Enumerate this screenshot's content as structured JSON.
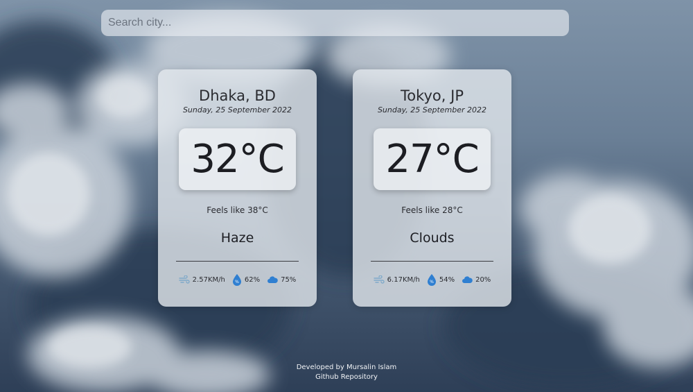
{
  "search": {
    "placeholder": "Search city..."
  },
  "cards": [
    {
      "city": "Dhaka, BD",
      "date": "Sunday, 25 September 2022",
      "temperature": "32°C",
      "feels_like": "Feels like 38°C",
      "condition": "Haze",
      "wind": "2.57KM/h",
      "humidity": "62%",
      "clouds": "75%"
    },
    {
      "city": "Tokyo, JP",
      "date": "Sunday, 25 September 2022",
      "temperature": "27°C",
      "feels_like": "Feels like 28°C",
      "condition": "Clouds",
      "wind": "6.17KM/h",
      "humidity": "54%",
      "clouds": "20%"
    }
  ],
  "footer": {
    "credit": "Developed by Mursalin Islam",
    "repo_link": "Github Repository"
  },
  "icons": {
    "wind": "wind-icon",
    "humidity": "water-drop-icon",
    "clouds": "cloud-icon"
  },
  "colors": {
    "icon_blue": "#2f7fd1",
    "wind_icon": "#7fa9c9"
  }
}
